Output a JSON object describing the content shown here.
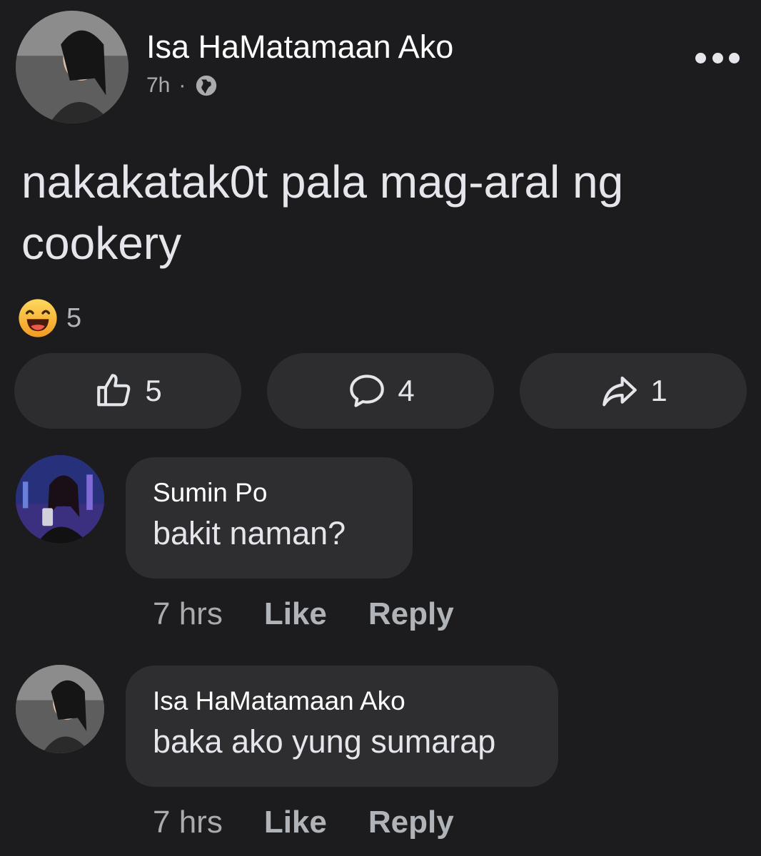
{
  "post": {
    "author": "Isa HaMatamaan Ako",
    "time": "7h",
    "separator": "·",
    "audience_icon": "globe-icon",
    "text": "nakakatak0t pala mag-aral ng cookery",
    "reaction_icon": "haha-emoji-icon",
    "reaction_count": "5"
  },
  "actions": {
    "like_count": "5",
    "comment_count": "4",
    "share_count": "1"
  },
  "comments": [
    {
      "author": "Sumin Po",
      "text": "bakit naman?",
      "time": "7 hrs",
      "like_label": "Like",
      "reply_label": "Reply"
    },
    {
      "author": "Isa HaMatamaan Ako",
      "text": "baka ako yung sumarap",
      "time": "7 hrs",
      "like_label": "Like",
      "reply_label": "Reply"
    }
  ],
  "colors": {
    "background": "#1c1c1e",
    "button": "#2d2d2f",
    "bubble": "#2e2e30",
    "haha": "#f7b928"
  }
}
